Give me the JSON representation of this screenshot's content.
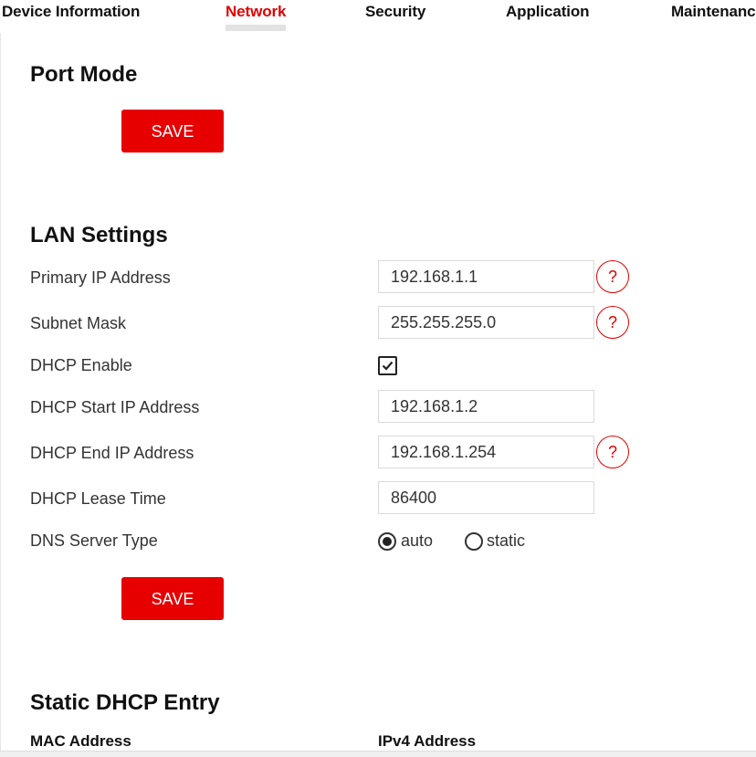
{
  "tabs": [
    {
      "label": "Device Information"
    },
    {
      "label": "Network"
    },
    {
      "label": "Security"
    },
    {
      "label": "Application"
    },
    {
      "label": "Maintenance"
    }
  ],
  "active_tab": "Network",
  "port_mode": {
    "title": "Port Mode",
    "save_label": "SAVE"
  },
  "lan": {
    "title": "LAN Settings",
    "primary_ip": {
      "label": "Primary IP Address",
      "value": "192.168.1.1"
    },
    "subnet": {
      "label": "Subnet Mask",
      "value": "255.255.255.0"
    },
    "dhcp_enable": {
      "label": "DHCP Enable",
      "checked": true
    },
    "dhcp_start": {
      "label": "DHCP Start IP Address",
      "value": "192.168.1.2"
    },
    "dhcp_end": {
      "label": "DHCP End IP Address",
      "value": "192.168.1.254"
    },
    "lease": {
      "label": "DHCP Lease Time",
      "value": "86400"
    },
    "dns": {
      "label": "DNS Server Type",
      "options": [
        "auto",
        "static"
      ],
      "selected": "auto"
    },
    "save_label": "SAVE",
    "help_symbol": "?"
  },
  "static_dhcp": {
    "title": "Static DHCP Entry",
    "columns": [
      "MAC Address",
      "IPv4 Address"
    ]
  },
  "colors": {
    "accent": "#e60000",
    "help_border": "#e00000"
  }
}
